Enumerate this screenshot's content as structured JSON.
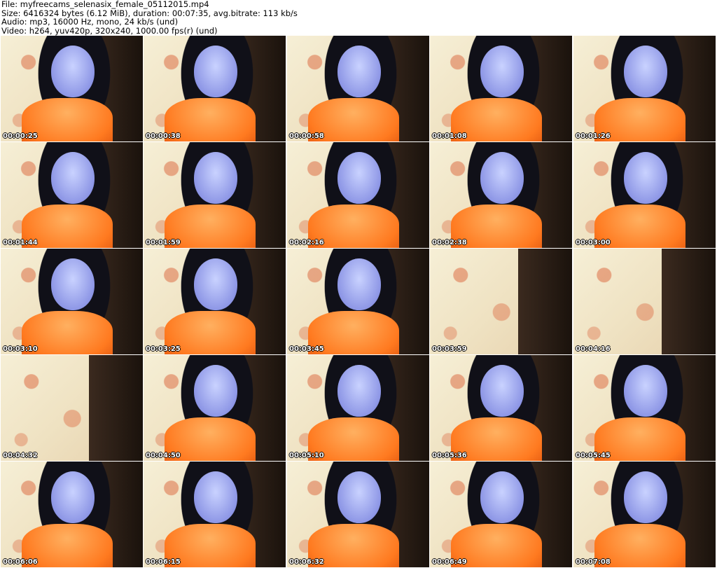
{
  "header": {
    "file_line": "File: myfreecams_selenasix_female_05112015.mp4",
    "size_line": "Size: 6416324 bytes (6.12 MiB), duration: 00:07:35, avg.bitrate: 113 kb/s",
    "audio_line": "Audio: mp3, 16000 Hz, mono, 24 kb/s (und)",
    "video_line": "Video: h264, yuv420p, 320x240, 1000.00 fps(r) (und)"
  },
  "thumbnails": [
    {
      "timestamp": "00:00:25"
    },
    {
      "timestamp": "00:00:38"
    },
    {
      "timestamp": "00:00:58"
    },
    {
      "timestamp": "00:01:08"
    },
    {
      "timestamp": "00:01:26"
    },
    {
      "timestamp": "00:01:44"
    },
    {
      "timestamp": "00:01:59"
    },
    {
      "timestamp": "00:02:16"
    },
    {
      "timestamp": "00:02:38"
    },
    {
      "timestamp": "00:03:00"
    },
    {
      "timestamp": "00:03:10"
    },
    {
      "timestamp": "00:03:25"
    },
    {
      "timestamp": "00:03:45"
    },
    {
      "timestamp": "00:03:59"
    },
    {
      "timestamp": "00:04:16"
    },
    {
      "timestamp": "00:04:32"
    },
    {
      "timestamp": "00:04:50"
    },
    {
      "timestamp": "00:05:10"
    },
    {
      "timestamp": "00:05:36"
    },
    {
      "timestamp": "00:05:45"
    },
    {
      "timestamp": "00:06:06"
    },
    {
      "timestamp": "00:06:15"
    },
    {
      "timestamp": "00:06:32"
    },
    {
      "timestamp": "00:06:49"
    },
    {
      "timestamp": "00:07:08"
    }
  ],
  "colors": {
    "background": "#ffffff",
    "timestamp_text": "#ffffff",
    "timestamp_outline": "#000000",
    "top_orange": "#ff7a20",
    "door_brown": "#2a1c14"
  }
}
